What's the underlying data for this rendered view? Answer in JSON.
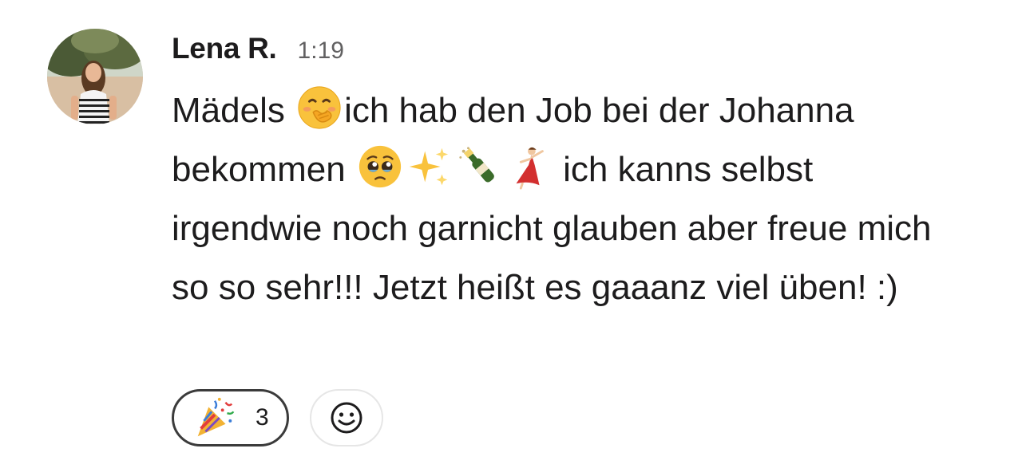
{
  "message": {
    "author": "Lena R.",
    "time": "1:19",
    "text_segments": [
      "Mädels ",
      "ich hab den Job bei der Johanna bekommen ",
      " ich kanns selbst irgendwie noch garnicht glauben aber freue mich so so sehr!!! Jetzt heißt es gaaanz viel üben! :)"
    ],
    "emojis": [
      "hand-over-mouth-emoji",
      "pleading-face-emoji",
      "sparkles-emoji",
      "champagne-emoji",
      "dancer-emoji"
    ]
  },
  "reactions": [
    {
      "icon": "party-popper-emoji",
      "count": "3"
    }
  ],
  "add_reaction": {
    "icon": "smiley-add-icon"
  },
  "colors": {
    "text": "#1d1c1d",
    "muted": "#616061",
    "reaction_border": "#3b3b3b",
    "add_border": "#e6e6e6"
  }
}
